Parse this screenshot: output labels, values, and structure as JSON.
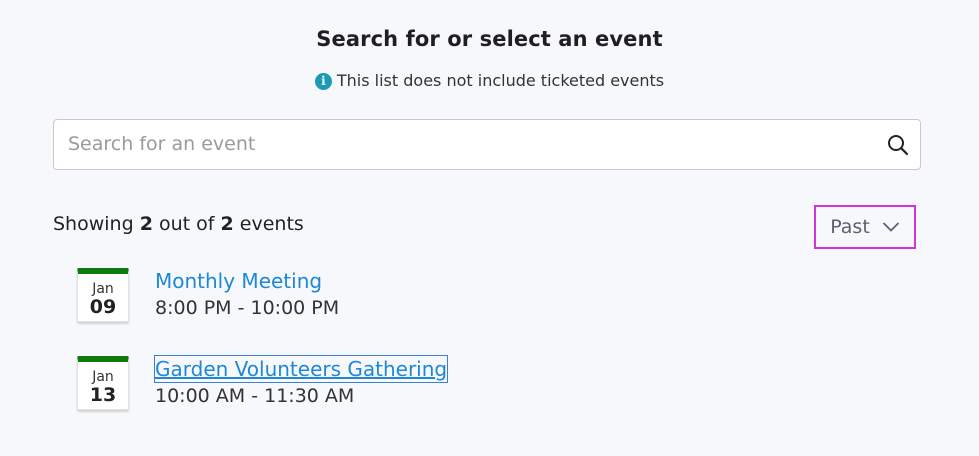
{
  "header": {
    "title": "Search for or select an event",
    "notice": "This list does not include ticketed events"
  },
  "search": {
    "placeholder": "Search for an event",
    "value": ""
  },
  "summary": {
    "prefix": "Showing",
    "shown": "2",
    "middle": "out of",
    "total": "2",
    "suffix": "events"
  },
  "filter": {
    "selected": "Past"
  },
  "events": [
    {
      "month": "Jan",
      "day": "09",
      "name": "Monthly Meeting",
      "time": "8:00 PM - 10:00 PM"
    },
    {
      "month": "Jan",
      "day": "13",
      "name": "Garden Volunteers Gathering",
      "time": "10:00 AM - 11:30 AM"
    }
  ],
  "colors": {
    "accent_link": "#1e88d6",
    "calendar_band": "#0e7a0e",
    "info_icon": "#1a9bb5",
    "filter_focus_border": "#d633d6"
  }
}
